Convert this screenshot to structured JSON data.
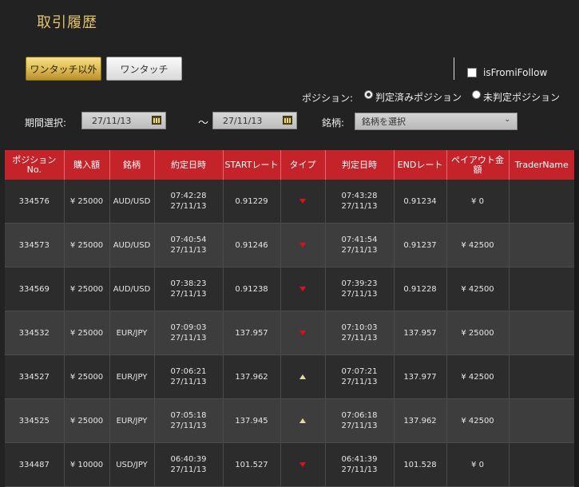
{
  "page": {
    "title": "取引履歴"
  },
  "tabs": {
    "active_label": "ワンタッチ以外",
    "inactive_label": "ワンタッチ"
  },
  "follow": {
    "label": "isFromiFollow",
    "checked": false
  },
  "position_filter": {
    "label": "ポジション:",
    "options": [
      {
        "label": "判定済みポジション",
        "selected": true
      },
      {
        "label": "未判定ポジション",
        "selected": false
      }
    ]
  },
  "period": {
    "label": "期間選択:",
    "from": "27/11/13",
    "separator": "～",
    "to": "27/11/13"
  },
  "brand": {
    "label": "銘柄:",
    "selected": "銘柄を選択"
  },
  "table": {
    "headers": [
      "ポジション No.",
      "購入額",
      "銘柄",
      "約定日時",
      "STARTレート",
      "タイプ",
      "判定日時",
      "ENDレート",
      "ペイアウト金額",
      "TraderName"
    ],
    "rows": [
      {
        "no": "334576",
        "amount": "¥ 25000",
        "symbol": "AUD/USD",
        "exec_time": "07:42:28",
        "exec_date": "27/11/13",
        "start": "0.91229",
        "type": "down",
        "judge_time": "07:43:28",
        "judge_date": "27/11/13",
        "end": "0.91234",
        "payout": "¥ 0",
        "trader": ""
      },
      {
        "no": "334573",
        "amount": "¥ 25000",
        "symbol": "AUD/USD",
        "exec_time": "07:40:54",
        "exec_date": "27/11/13",
        "start": "0.91246",
        "type": "down",
        "judge_time": "07:41:54",
        "judge_date": "27/11/13",
        "end": "0.91237",
        "payout": "¥ 42500",
        "trader": ""
      },
      {
        "no": "334569",
        "amount": "¥ 25000",
        "symbol": "AUD/USD",
        "exec_time": "07:38:23",
        "exec_date": "27/11/13",
        "start": "0.91238",
        "type": "down",
        "judge_time": "07:39:23",
        "judge_date": "27/11/13",
        "end": "0.91228",
        "payout": "¥ 42500",
        "trader": ""
      },
      {
        "no": "334532",
        "amount": "¥ 25000",
        "symbol": "EUR/JPY",
        "exec_time": "07:09:03",
        "exec_date": "27/11/13",
        "start": "137.957",
        "type": "down",
        "judge_time": "07:10:03",
        "judge_date": "27/11/13",
        "end": "137.957",
        "payout": "¥ 25000",
        "trader": ""
      },
      {
        "no": "334527",
        "amount": "¥ 25000",
        "symbol": "EUR/JPY",
        "exec_time": "07:06:21",
        "exec_date": "27/11/13",
        "start": "137.962",
        "type": "up",
        "judge_time": "07:07:21",
        "judge_date": "27/11/13",
        "end": "137.977",
        "payout": "¥ 42500",
        "trader": ""
      },
      {
        "no": "334525",
        "amount": "¥ 25000",
        "symbol": "EUR/JPY",
        "exec_time": "07:05:18",
        "exec_date": "27/11/13",
        "start": "137.945",
        "type": "up",
        "judge_time": "07:06:18",
        "judge_date": "27/11/13",
        "end": "137.962",
        "payout": "¥ 42500",
        "trader": ""
      },
      {
        "no": "334487",
        "amount": "¥ 10000",
        "symbol": "USD/JPY",
        "exec_time": "06:40:39",
        "exec_date": "27/11/13",
        "start": "101.527",
        "type": "down",
        "judge_time": "06:41:39",
        "judge_date": "27/11/13",
        "end": "101.528",
        "payout": "¥ 0",
        "trader": ""
      }
    ]
  },
  "colors": {
    "header_red": "#c4232a",
    "gold": "#e2c36b",
    "down": "#e0101a",
    "up": "#e7d8a2"
  }
}
